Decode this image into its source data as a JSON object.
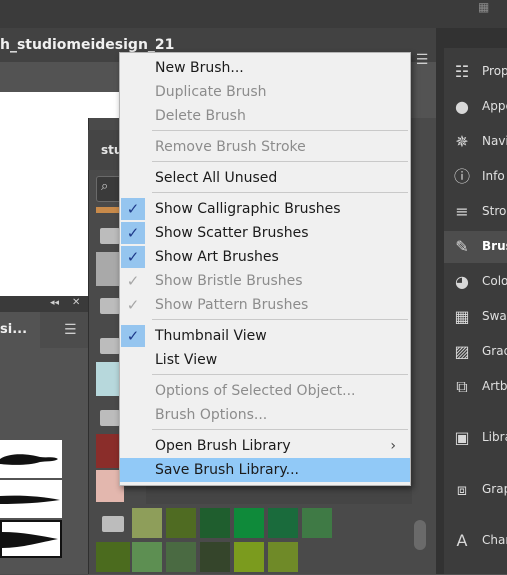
{
  "document": {
    "title": "h_studiomeidesign_21"
  },
  "panel": {
    "title": "stu",
    "tab_label": "si..."
  },
  "menu": {
    "items": [
      {
        "label": "New Brush...",
        "enabled": true,
        "check": "none"
      },
      {
        "label": "Duplicate Brush",
        "enabled": false,
        "check": "none"
      },
      {
        "label": "Delete Brush",
        "enabled": false,
        "check": "none"
      },
      {
        "label": "Remove Brush Stroke",
        "enabled": false,
        "check": "none"
      },
      {
        "label": "Select All Unused",
        "enabled": true,
        "check": "none"
      },
      {
        "label": "Show Calligraphic Brushes",
        "enabled": true,
        "check": "on"
      },
      {
        "label": "Show Scatter Brushes",
        "enabled": true,
        "check": "on"
      },
      {
        "label": "Show Art Brushes",
        "enabled": true,
        "check": "on"
      },
      {
        "label": "Show Bristle Brushes",
        "enabled": false,
        "check": "off"
      },
      {
        "label": "Show Pattern Brushes",
        "enabled": false,
        "check": "off"
      },
      {
        "label": "Thumbnail View",
        "enabled": true,
        "check": "on"
      },
      {
        "label": "List View",
        "enabled": true,
        "check": "none"
      },
      {
        "label": "Options of Selected Object...",
        "enabled": false,
        "check": "none"
      },
      {
        "label": "Brush Options...",
        "enabled": false,
        "check": "none"
      },
      {
        "label": "Open Brush Library",
        "enabled": true,
        "check": "none",
        "submenu": true
      },
      {
        "label": "Save Brush Library...",
        "enabled": true,
        "check": "none",
        "highlighted": true
      }
    ],
    "check_glyph": "✓",
    "submenu_glyph": "›"
  },
  "right_panel": {
    "items": [
      {
        "label": "Prop",
        "icon": "properties-icon"
      },
      {
        "label": "Appe",
        "icon": "appearance-icon"
      },
      {
        "label": "Navi",
        "icon": "navigator-icon"
      },
      {
        "label": "Info",
        "icon": "info-icon"
      },
      {
        "label": "Stro",
        "icon": "stroke-icon"
      },
      {
        "label": "Brus",
        "icon": "brushes-icon",
        "active": true
      },
      {
        "label": "Colo",
        "icon": "color-icon"
      },
      {
        "label": "Swa",
        "icon": "swatches-icon"
      },
      {
        "label": "Grad",
        "icon": "gradient-icon"
      },
      {
        "label": "Artb",
        "icon": "artboards-icon"
      },
      {
        "label": "Libra",
        "icon": "libraries-icon"
      },
      {
        "label": "Grap",
        "icon": "graphic-styles-icon"
      },
      {
        "label": "Char",
        "icon": "character-icon"
      }
    ]
  },
  "colors": {
    "menu_bg": "#f0f0f0",
    "menu_highlight": "#91c9f7",
    "check_bg": "#95c5ef",
    "ui_dark": "#535353"
  }
}
